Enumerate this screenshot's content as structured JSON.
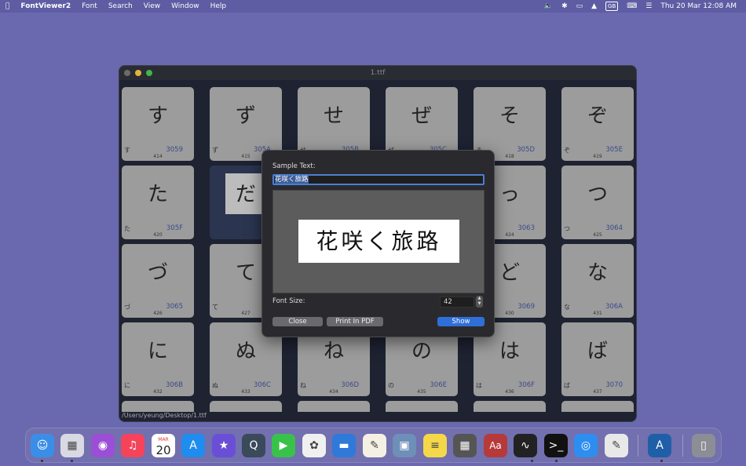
{
  "menubar": {
    "apple": "",
    "app_name": "FontViewer2",
    "menus": [
      "Font",
      "Search",
      "View",
      "Window",
      "Help"
    ],
    "status": {
      "input_source": "GB",
      "clock": "Thu 20 Mar  12:08 AM"
    }
  },
  "window": {
    "title": "1.ttf",
    "status_path": "/Users/yeung/Desktop/1.ttf",
    "cells": [
      {
        "glyph": "す",
        "small": "す",
        "code": "3059",
        "num": "414"
      },
      {
        "glyph": "ず",
        "small": "ず",
        "code": "305A",
        "num": "415"
      },
      {
        "glyph": "せ",
        "small": "せ",
        "code": "305B",
        "num": "416"
      },
      {
        "glyph": "ぜ",
        "small": "ぜ",
        "code": "305C",
        "num": "417"
      },
      {
        "glyph": "そ",
        "small": "そ",
        "code": "305D",
        "num": "418"
      },
      {
        "glyph": "ぞ",
        "small": "ぞ",
        "code": "305E",
        "num": "419"
      },
      {
        "glyph": "た",
        "small": "た",
        "code": "305F",
        "num": "420"
      },
      {
        "glyph": "だ",
        "small": "",
        "code": "",
        "num": "421"
      },
      {
        "glyph": "",
        "small": "",
        "code": "",
        "num": ""
      },
      {
        "glyph": "",
        "small": "",
        "code": "",
        "num": ""
      },
      {
        "glyph": "っ",
        "small": "",
        "code": "3063",
        "num": "424"
      },
      {
        "glyph": "つ",
        "small": "つ",
        "code": "3064",
        "num": "425"
      },
      {
        "glyph": "づ",
        "small": "づ",
        "code": "3065",
        "num": "426"
      },
      {
        "glyph": "て",
        "small": "て",
        "code": "30",
        "num": "427"
      },
      {
        "glyph": "",
        "small": "",
        "code": "",
        "num": ""
      },
      {
        "glyph": "",
        "small": "",
        "code": "",
        "num": ""
      },
      {
        "glyph": "ど",
        "small": "",
        "code": "3069",
        "num": "430"
      },
      {
        "glyph": "な",
        "small": "な",
        "code": "306A",
        "num": "431"
      },
      {
        "glyph": "に",
        "small": "に",
        "code": "306B",
        "num": "432"
      },
      {
        "glyph": "ぬ",
        "small": "ぬ",
        "code": "306C",
        "num": "433"
      },
      {
        "glyph": "ね",
        "small": "ね",
        "code": "306D",
        "num": "434"
      },
      {
        "glyph": "の",
        "small": "の",
        "code": "306E",
        "num": "435"
      },
      {
        "glyph": "は",
        "small": "は",
        "code": "306F",
        "num": "436"
      },
      {
        "glyph": "ば",
        "small": "ば",
        "code": "3070",
        "num": "437"
      }
    ]
  },
  "dialog": {
    "sample_label": "Sample Text:",
    "sample_value": "花咲く旅路",
    "preview_text": "花咲く旅路",
    "font_size_label": "Font Size:",
    "font_size_value": "42",
    "buttons": {
      "close": "Close",
      "print_pdf": "Print In PDF",
      "show": "Show"
    }
  },
  "dock": {
    "calendar_month": "MAR",
    "calendar_day": "20",
    "dictionary_label": "Aa",
    "items": [
      "finder-icon",
      "launchpad-icon",
      "podcasts-icon",
      "music-icon",
      "calendar-icon",
      "app-store-icon",
      "imovie-icon",
      "quicktime-icon",
      "facetime-icon",
      "photos-icon",
      "keynote-icon",
      "textedit-icon",
      "preview-icon",
      "notes-icon",
      "calculator-icon",
      "dictionary-icon",
      "activity-monitor-icon",
      "terminal-icon",
      "safari-icon",
      "script-editor-icon",
      "font-book-icon",
      "trash-icon"
    ]
  },
  "colors": {
    "desktop": "#6a68ae",
    "accent": "#2f6fd8",
    "cell": "#9c9c9c",
    "code_text": "#3b4a8a"
  }
}
